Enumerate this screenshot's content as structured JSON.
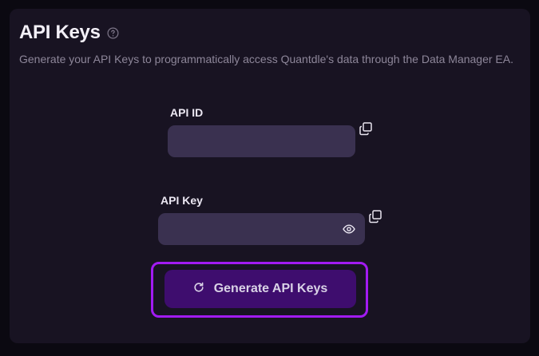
{
  "header": {
    "title": "API Keys",
    "subtitle": "Generate your API Keys to programmatically access Quantdle's data through the Data Manager EA."
  },
  "fields": {
    "api_id": {
      "label": "API ID",
      "value": ""
    },
    "api_key": {
      "label": "API Key",
      "value": ""
    }
  },
  "actions": {
    "generate_label": "Generate API Keys"
  },
  "icons": {
    "help": "help-circle-icon",
    "copy": "copy-icon",
    "visibility": "eye-icon",
    "refresh": "refresh-icon"
  },
  "colors": {
    "background": "#0b0911",
    "card": "#181322",
    "field": "#3a3150",
    "accent": "#a21bf2",
    "button": "#3e0d6e"
  }
}
